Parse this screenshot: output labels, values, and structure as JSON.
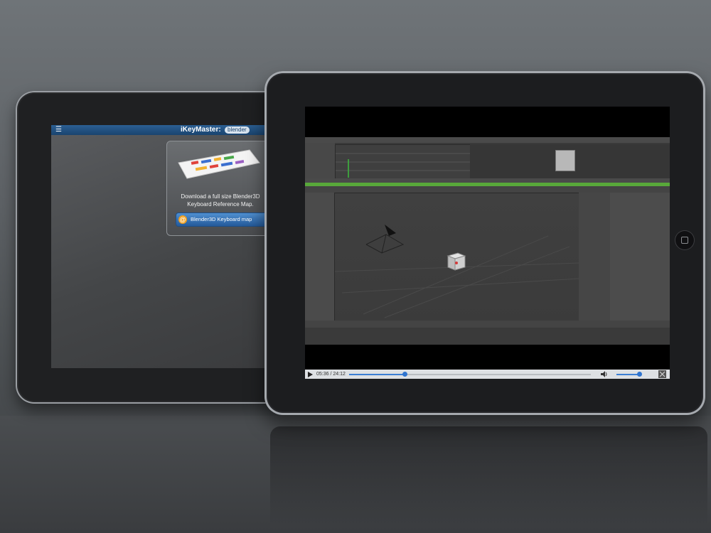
{
  "back_tablet": {
    "menu_icon": "hamburger-icon",
    "brand_prefix": "i",
    "brand_text": "KeyMaster:",
    "brand_badge": "blender",
    "card_text": "Download a full size Blender3D Keyboard Reference Map.",
    "button_label": "Blender3D Keyboard map",
    "button_icon": "@"
  },
  "front_tablet": {
    "video": {
      "current_time": "05:36",
      "total_time": "24:12",
      "time_display": "05:36 / 24:12",
      "progress": 0.23,
      "volume": 0.95
    }
  },
  "colors": {
    "header_blue": "#1f4f80",
    "progress_blue": "#2f74cf",
    "timeline_green": "#58a83a"
  }
}
